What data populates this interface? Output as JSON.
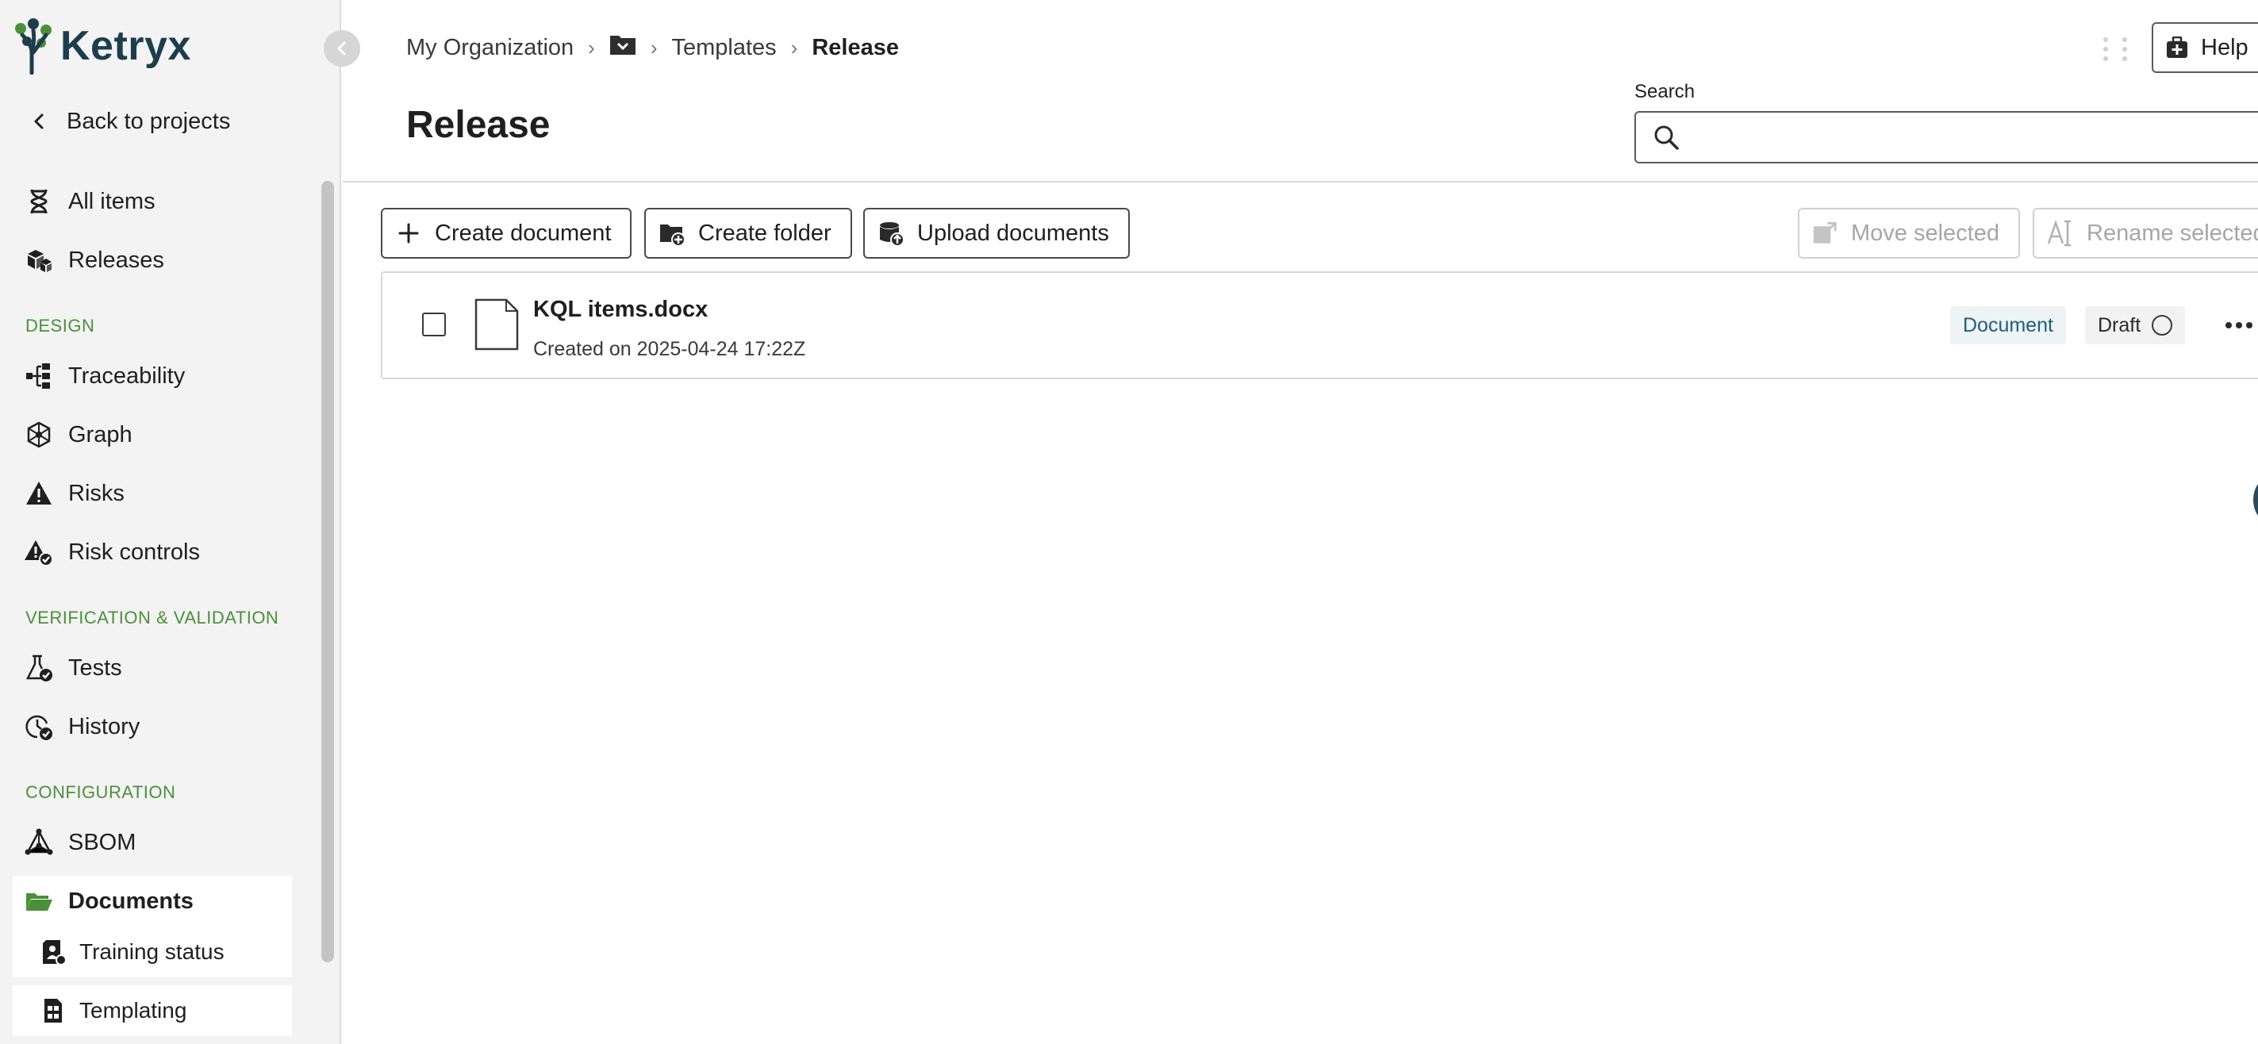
{
  "app": {
    "logo_text": "Ketryx",
    "brand_color": "#1e3d4c",
    "accent_color": "#4b8f3a"
  },
  "sidebar": {
    "back_label": "Back to projects",
    "top_items": [
      {
        "label": "All items",
        "icon": "dna-icon"
      },
      {
        "label": "Releases",
        "icon": "boxes-icon"
      }
    ],
    "sections": [
      {
        "title": "DESIGN",
        "items": [
          {
            "label": "Traceability",
            "icon": "traceability-icon"
          },
          {
            "label": "Graph",
            "icon": "graph-icon"
          },
          {
            "label": "Risks",
            "icon": "warning-icon"
          },
          {
            "label": "Risk controls",
            "icon": "risk-control-icon"
          }
        ]
      },
      {
        "title": "VERIFICATION & VALIDATION",
        "items": [
          {
            "label": "Tests",
            "icon": "flask-check-icon"
          },
          {
            "label": "History",
            "icon": "history-check-icon"
          }
        ]
      },
      {
        "title": "CONFIGURATION",
        "items": [
          {
            "label": "SBOM",
            "icon": "sbom-icon"
          },
          {
            "label": "Documents",
            "icon": "folder-open-icon",
            "active": true
          }
        ]
      }
    ],
    "sub_items": [
      {
        "label": "Training status",
        "icon": "training-icon"
      },
      {
        "label": "Templating",
        "icon": "templating-icon"
      }
    ]
  },
  "header": {
    "breadcrumb": {
      "org": "My Organization",
      "folder_icon": "folder-icon",
      "templates": "Templates",
      "current": "Release"
    },
    "title": "Release",
    "help_label": "Help",
    "search_label": "Search",
    "search_value": "",
    "search_placeholder": ""
  },
  "toolbar": {
    "create_document": "Create document",
    "create_folder": "Create folder",
    "upload_documents": "Upload documents",
    "move_selected": "Move selected",
    "rename_selected": "Rename selected"
  },
  "documents": [
    {
      "name": "KQL items.docx",
      "meta": "Created on 2025-04-24 17:22Z",
      "type_badge": "Document",
      "status": "Draft"
    }
  ]
}
